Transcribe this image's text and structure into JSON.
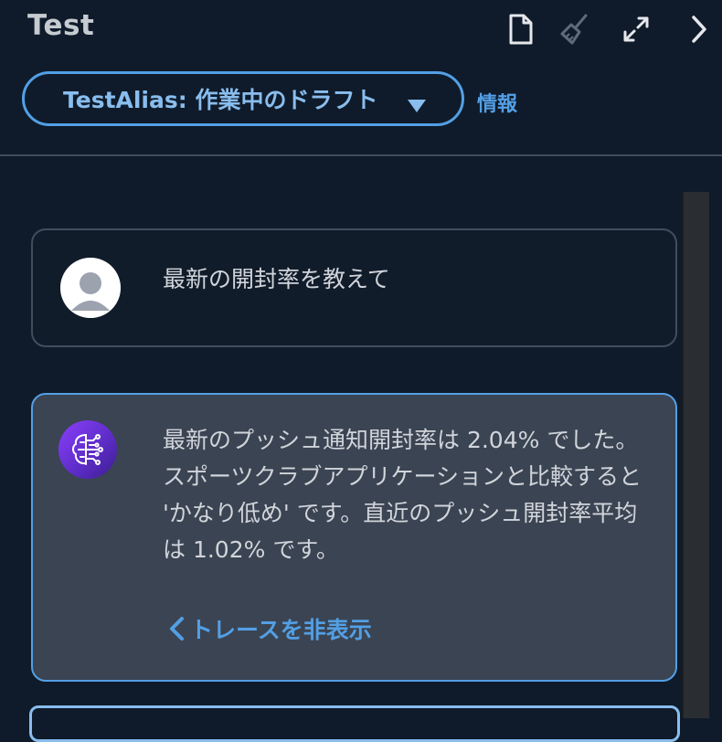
{
  "header": {
    "title": "Test",
    "icons": [
      "document-icon",
      "clear-broom-icon",
      "expand-icon",
      "chevron-right-icon"
    ]
  },
  "alias_select": {
    "label": "TestAlias: 作業中のドラフト",
    "info_link": "情報"
  },
  "conversation": {
    "user_message": "最新の開封率を教えて",
    "agent_message": "最新のプッシュ通知開封率は 2.04% でした。スポーツクラブアプリケーションと比較すると 'かなり低め' です。直近のプッシュ開封率平均は 1.02% です。",
    "trace_toggle": "トレースを非表示"
  },
  "colors": {
    "background": "#0f1b2a",
    "accent": "#539fe5",
    "agent_bubble": "#3b4452"
  }
}
